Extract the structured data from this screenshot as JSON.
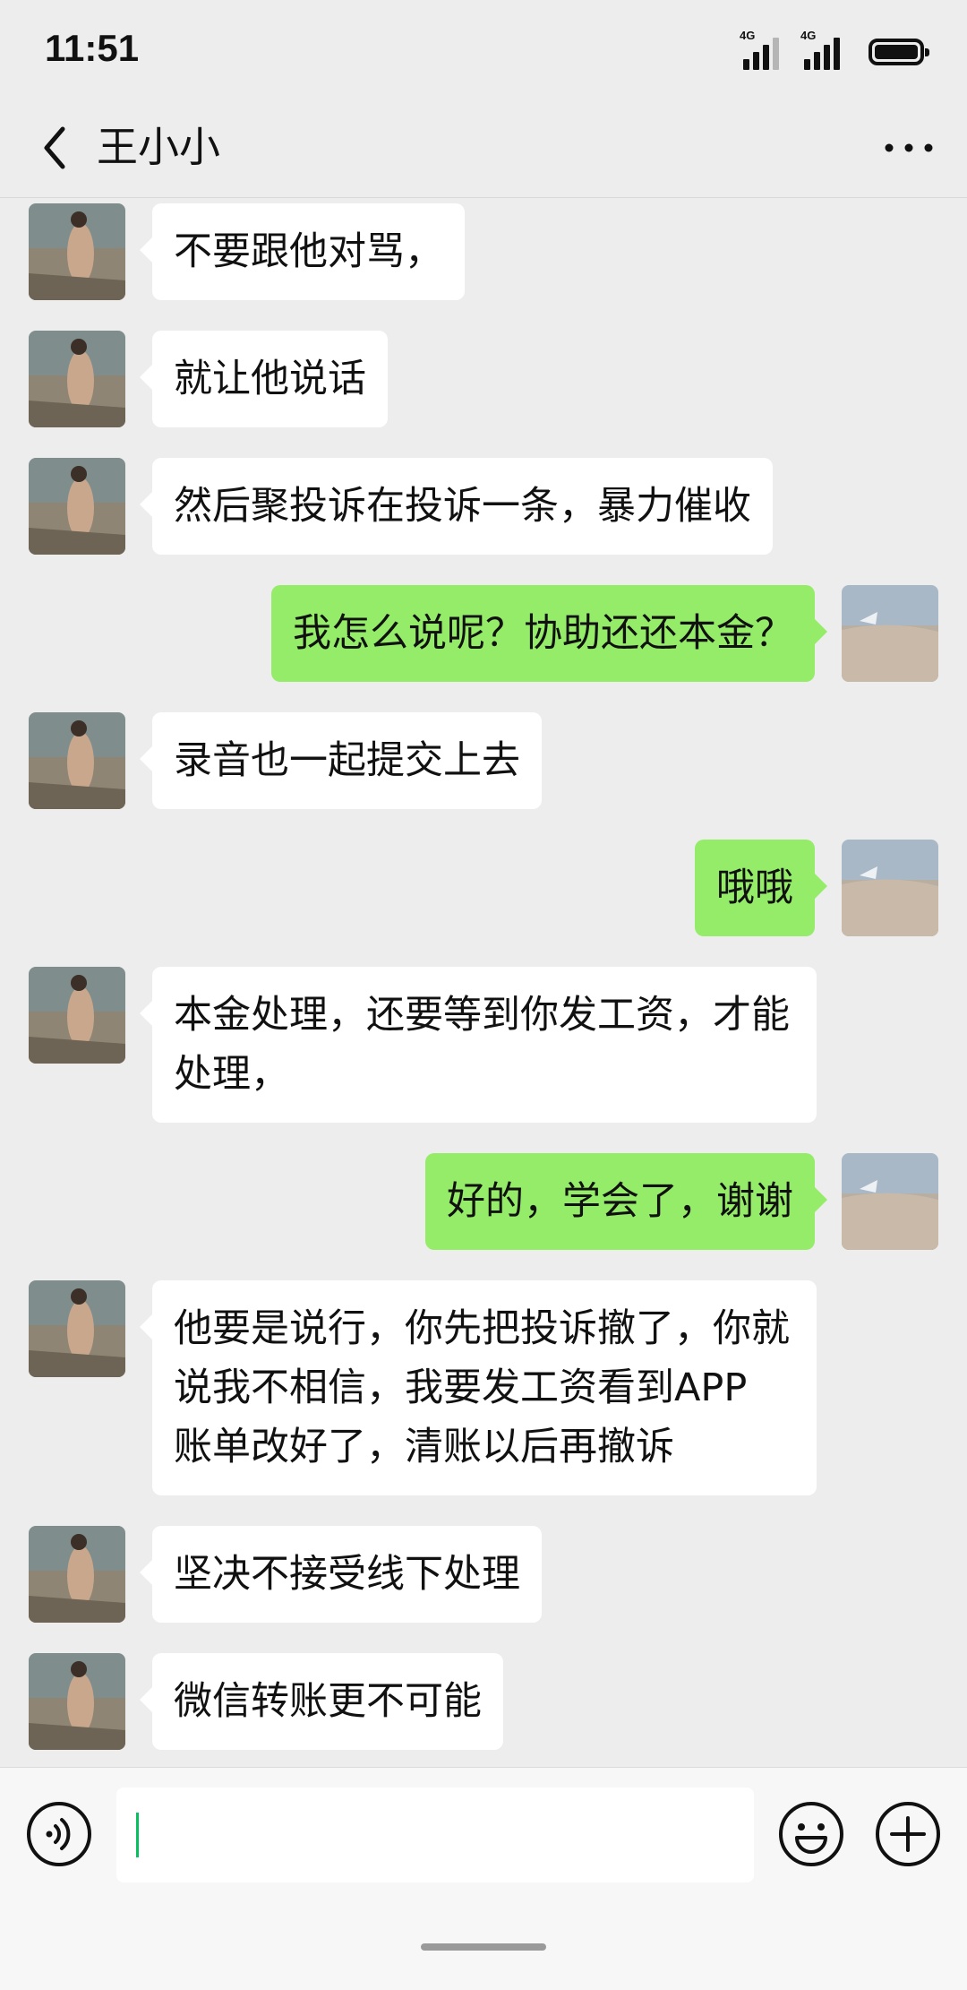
{
  "status_bar": {
    "time": "11:51",
    "network_1": "4G",
    "network_2": "4G"
  },
  "header": {
    "title": "王小小",
    "back_icon": "chevron-left-icon",
    "more_icon": "more-dots-icon"
  },
  "messages": [
    {
      "side": "left",
      "text": "不要跟他对骂，"
    },
    {
      "side": "left",
      "text": "就让他说话"
    },
    {
      "side": "left",
      "text": "然后聚投诉在投诉一条，暴力催收"
    },
    {
      "side": "right",
      "text": "我怎么说呢？协助还还本金？"
    },
    {
      "side": "left",
      "text": "录音也一起提交上去"
    },
    {
      "side": "right",
      "text": "哦哦"
    },
    {
      "side": "left",
      "text": "本金处理，还要等到你发工资，才能处理，"
    },
    {
      "side": "right",
      "text": "好的，学会了，谢谢"
    },
    {
      "side": "left",
      "text": "他要是说行，你先把投诉撤了，你就说我不相信，我要发工资看到APP 账单改好了，清账以后再撤诉"
    },
    {
      "side": "left",
      "text": "坚决不接受线下处理"
    },
    {
      "side": "left",
      "text": "微信转账更不可能"
    }
  ],
  "input_bar": {
    "value": "",
    "voice_icon": "voice-icon",
    "emoji_icon": "emoji-icon",
    "plus_icon": "plus-icon"
  },
  "colors": {
    "background": "#ededed",
    "bubble_self": "#95ec69",
    "bubble_other": "#ffffff",
    "caret": "#07c160"
  }
}
